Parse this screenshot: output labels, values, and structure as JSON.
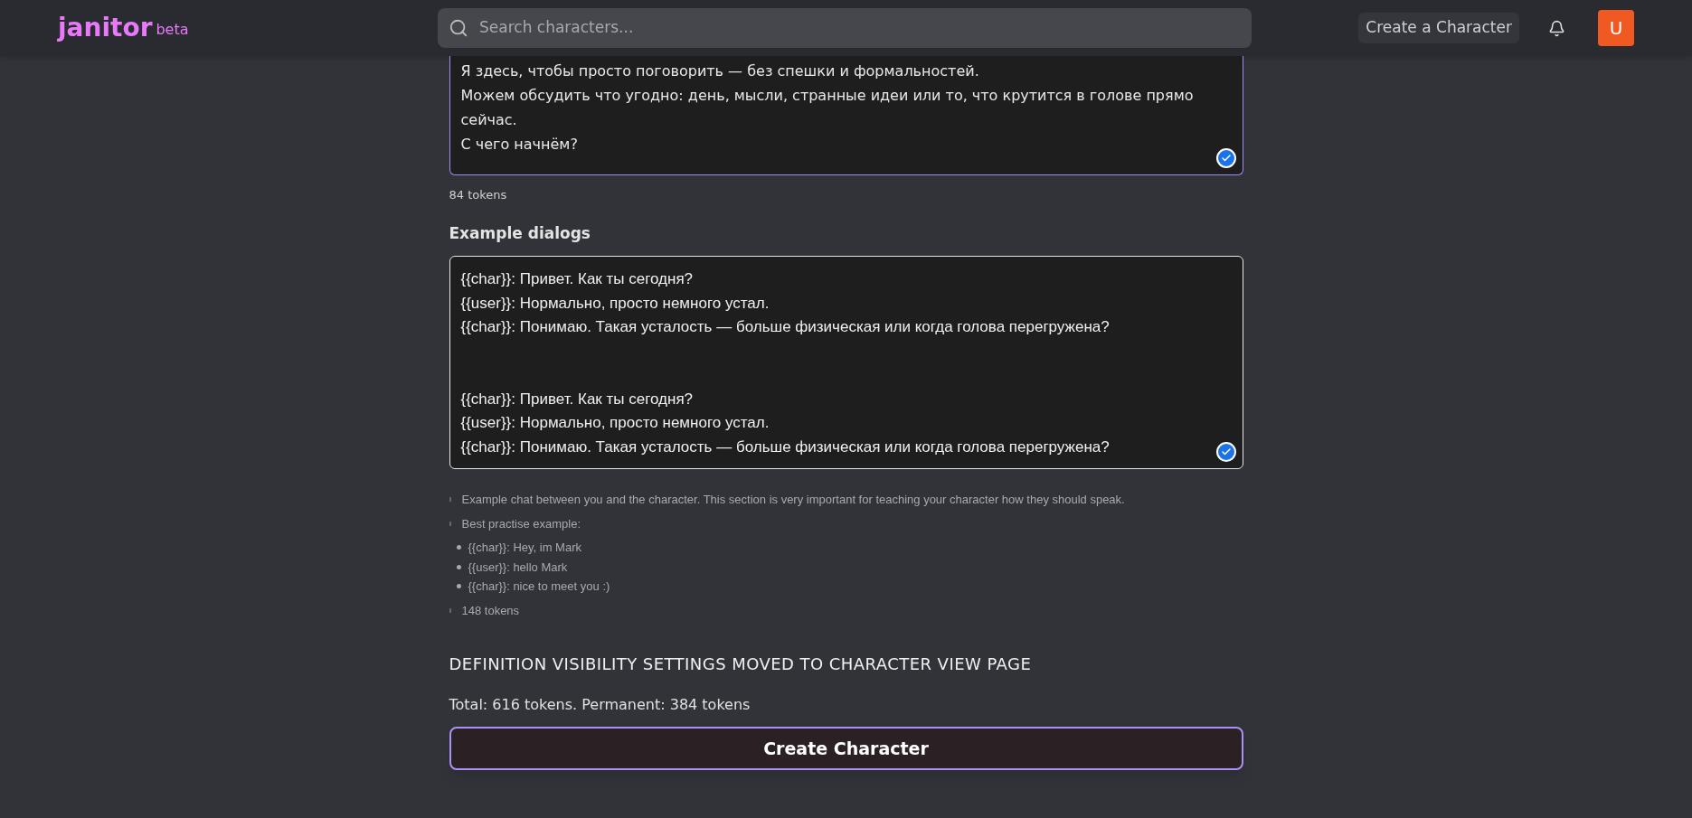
{
  "header": {
    "logo": "janitor",
    "logo_badge": "beta",
    "search": {
      "placeholder": "Search characters..."
    },
    "create_link": "Create a Character",
    "avatar": "U"
  },
  "greeting": {
    "lines": [
      "Я здесь, чтобы просто поговорить — без спешки и формальностей.",
      "Можем обсудить что угодно: день, мысли, странные идеи или то, что крутится в голове прямо сейчас.",
      "С чего начнём?"
    ],
    "tokens": "84 tokens"
  },
  "example_dialogs": {
    "label": "Example dialogs",
    "blocks": [
      [
        "{{char}}: Привет. Как ты сегодня?",
        "{{user}}: Нормально, просто немного устал.",
        "{{char}}: Понимаю. Такая усталость — больше физическая или когда голова перегружена?"
      ],
      [
        "{{char}}: Привет. Как ты сегодня?",
        "{{user}}: Нормально, просто немного устал.",
        "{{char}}: Понимаю. Такая усталость — больше физическая или когда голова перегружена?"
      ]
    ],
    "help": "Example chat between you and the character. This section is very important for teaching your character how they should speak.",
    "example_title": "Best practise example:",
    "examples": [
      "{{char}}: Hey, im Mark",
      "{{user}}: hello Mark",
      "{{char}}: nice to meet you :)"
    ],
    "tokens": "148 tokens"
  },
  "notice": "DEFINITION VISIBILITY SETTINGS MOVED TO CHARACTER VIEW PAGE",
  "totals": "Total: 616 tokens. Permanent: 384 tokens",
  "submit": "Create Character"
}
